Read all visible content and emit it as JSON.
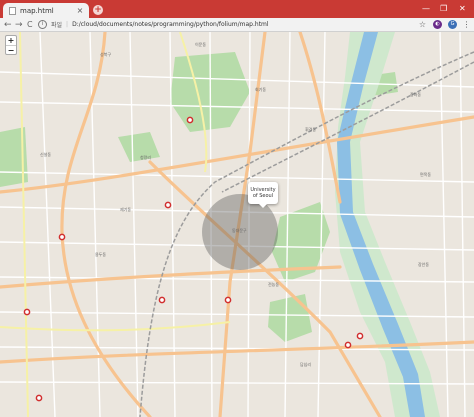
{
  "browser": {
    "tab_title": "map.html",
    "tab_close": "×",
    "new_tab": "+",
    "window_controls": [
      "—",
      "❐",
      "✕"
    ],
    "nav": {
      "back": "←",
      "forward": "→",
      "reload": "C"
    },
    "address": {
      "info_icon": "i",
      "scheme": "파일",
      "separator": "|",
      "path": "D:/cloud/documents/notes/programming/python/folium/map.html"
    },
    "toolbar_icons": {
      "bookmark": "☆",
      "extension": "◐",
      "profile": "G",
      "menu": "⋮"
    },
    "colors": {
      "frame": "#c93a34",
      "toolbar": "#f2f2f2"
    }
  },
  "map": {
    "zoom_in": "+",
    "zoom_out": "−",
    "popup_text": [
      "University",
      "of Seoul"
    ],
    "circle_color": "#555555",
    "area_labels": [
      "동대문구",
      "청량리",
      "이문동",
      "휘경동",
      "전농동",
      "답십리",
      "용두동",
      "제기동",
      "장안동",
      "회기동",
      "신설동",
      "면목동",
      "중화동",
      "성북구"
    ],
    "colors": {
      "land": "#ebe6de",
      "major_road": "#f7c38f",
      "minor_road": "#ffffff",
      "river": "#8cbfe4",
      "riverbank": "#cfe8cd",
      "park": "#b7dcaa",
      "railway": "#9c9c9c",
      "metro_marker": "#d12f2f"
    }
  }
}
